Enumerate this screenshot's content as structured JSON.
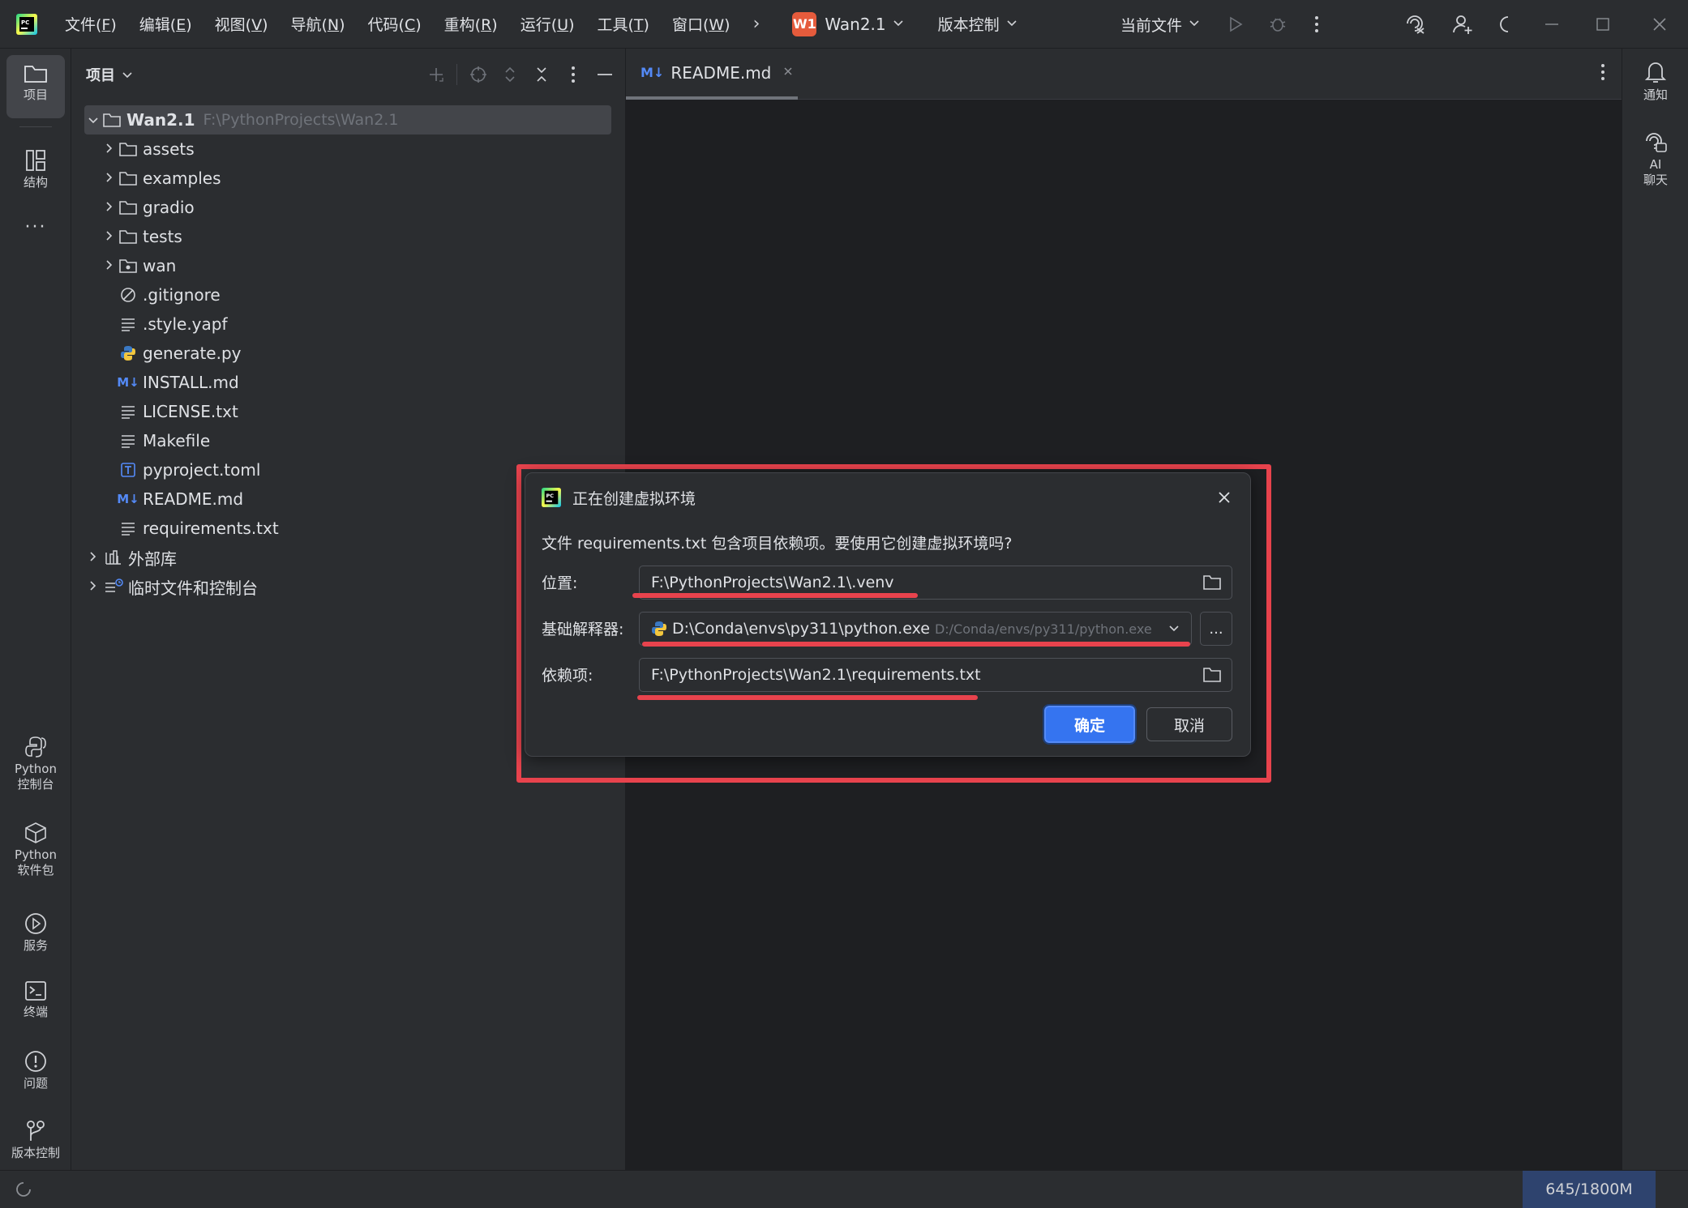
{
  "menu": {
    "items": [
      {
        "label": "文件(",
        "key": "F",
        "end": ")"
      },
      {
        "label": "编辑(",
        "key": "E",
        "end": ")"
      },
      {
        "label": "视图(",
        "key": "V",
        "end": ")"
      },
      {
        "label": "导航(",
        "key": "N",
        "end": ")"
      },
      {
        "label": "代码(",
        "key": "C",
        "end": ")"
      },
      {
        "label": "重构(",
        "key": "R",
        "end": ")"
      },
      {
        "label": "运行(",
        "key": "U",
        "end": ")"
      },
      {
        "label": "工具(",
        "key": "T",
        "end": ")"
      },
      {
        "label": "窗口(",
        "key": "W",
        "end": ")"
      }
    ],
    "overflow": "›"
  },
  "project_selector": {
    "badge": "W1",
    "name": "Wan2.1"
  },
  "vcs_selector": {
    "label": "版本控制"
  },
  "run_config": {
    "label": "当前文件"
  },
  "activity": {
    "project": "项目",
    "structure": "结构",
    "more": "···",
    "python_console": "Python\n控制台",
    "python_packages": "Python\n软件包",
    "services": "服务",
    "terminal": "终端",
    "problems": "问题",
    "vcs": "版本控制"
  },
  "project_panel": {
    "title": "项目",
    "root": {
      "name": "Wan2.1",
      "path": "F:\\PythonProjects\\Wan2.1"
    },
    "items": [
      {
        "name": "assets",
        "type": "folder"
      },
      {
        "name": "examples",
        "type": "folder"
      },
      {
        "name": "gradio",
        "type": "folder"
      },
      {
        "name": "tests",
        "type": "folder"
      },
      {
        "name": "wan",
        "type": "package"
      },
      {
        "name": ".gitignore",
        "type": "ignore"
      },
      {
        "name": ".style.yapf",
        "type": "text"
      },
      {
        "name": "generate.py",
        "type": "python"
      },
      {
        "name": "INSTALL.md",
        "type": "markdown"
      },
      {
        "name": "LICENSE.txt",
        "type": "text"
      },
      {
        "name": "Makefile",
        "type": "text"
      },
      {
        "name": "pyproject.toml",
        "type": "toml"
      },
      {
        "name": "README.md",
        "type": "markdown"
      },
      {
        "name": "requirements.txt",
        "type": "text"
      }
    ],
    "external_libs": "外部库",
    "scratches": "临时文件和控制台"
  },
  "editor": {
    "tab": {
      "prefix": "M↓",
      "name": "README.md"
    }
  },
  "rightbar": {
    "notifications": "通知",
    "ai_chat": "AI\n聊天"
  },
  "status": {
    "memory": "645/1800M"
  },
  "dialog": {
    "title": "正在创建虚拟环境",
    "message": "文件 requirements.txt 包含项目依赖项。要使用它创建虚拟环境吗?",
    "location_label": "位置:",
    "location_value": "F:\\PythonProjects\\Wan2.1\\.venv",
    "interpreter_label": "基础解释器:",
    "interpreter_value": "D:\\Conda\\envs\\py311\\python.exe",
    "interpreter_hint": "D:/Conda/envs/py311/python.exe",
    "browse_label": "...",
    "deps_label": "依赖项:",
    "deps_value": "F:\\PythonProjects\\Wan2.1\\requirements.txt",
    "ok_label": "确定",
    "cancel_label": "取消"
  },
  "colors": {
    "accent": "#3574f0",
    "highlight": "#e8434d",
    "badge": "#e55b3c",
    "background": "#1e1f22",
    "panel": "#2b2d30"
  }
}
